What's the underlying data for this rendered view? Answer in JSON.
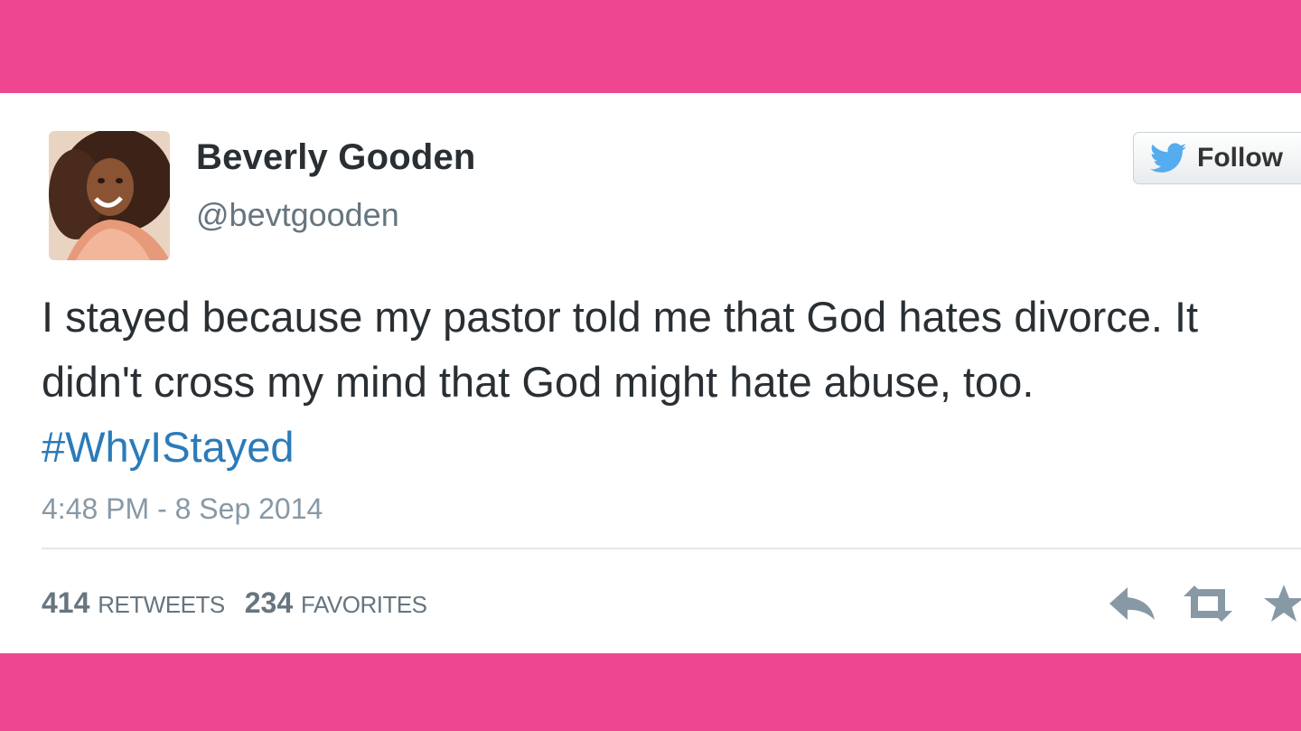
{
  "colors": {
    "band": "#ee4691",
    "card": "#ffffff",
    "name": "#292f33",
    "secondary": "#8899a6",
    "link": "#2b7bb9",
    "twitter_blue": "#55acee"
  },
  "tweet": {
    "display_name": "Beverly Gooden",
    "handle": "@bevtgooden",
    "follow_label": "Follow",
    "text": "I stayed because my pastor told me that God hates divorce. It didn't cross my mind that God might hate abuse, too. ",
    "hashtag": "#WhyIStayed",
    "timestamp": "4:48 PM - 8 Sep 2014",
    "retweets": {
      "count": "414",
      "label": "RETWEETS"
    },
    "favorites": {
      "count": "234",
      "label": "FAVORITES"
    }
  },
  "icons": {
    "bird": "twitter-bird-icon",
    "reply": "reply-icon",
    "retweet": "retweet-icon",
    "favorite": "star-icon"
  }
}
